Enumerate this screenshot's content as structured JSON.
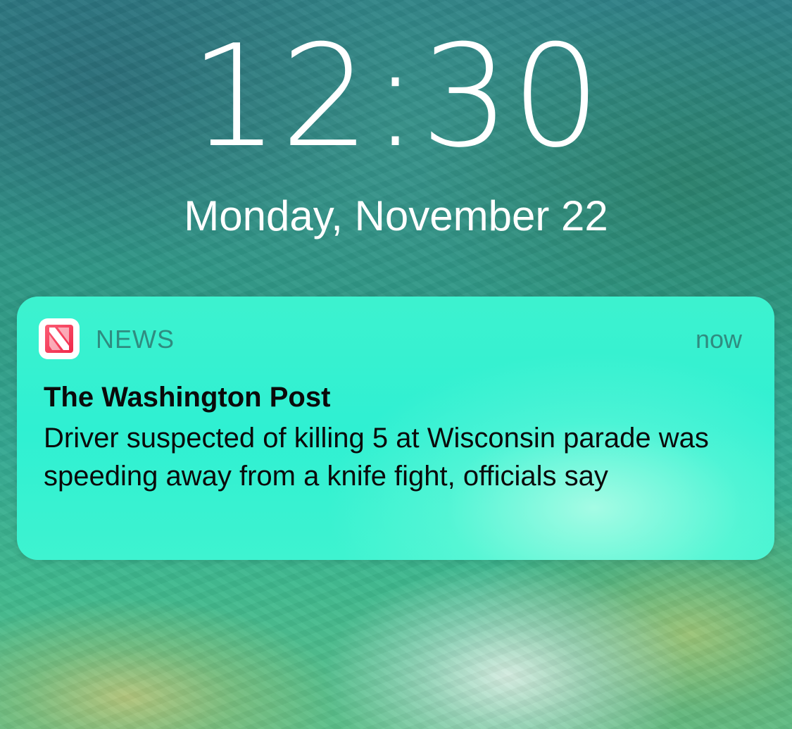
{
  "lockscreen": {
    "time": "12:30",
    "date": "Monday, November 22"
  },
  "notification": {
    "app_name": "NEWS",
    "app_icon": "apple-news-icon",
    "timestamp": "now",
    "title": "The Washington Post",
    "body": "Driver suspected of killing 5 at Wisconsin parade was speeding away from a knife fight, officials say"
  },
  "colors": {
    "notification_background": "#2ff0d2",
    "app_name_text": "#2f8c80",
    "news_icon_red": "#f0284a"
  }
}
